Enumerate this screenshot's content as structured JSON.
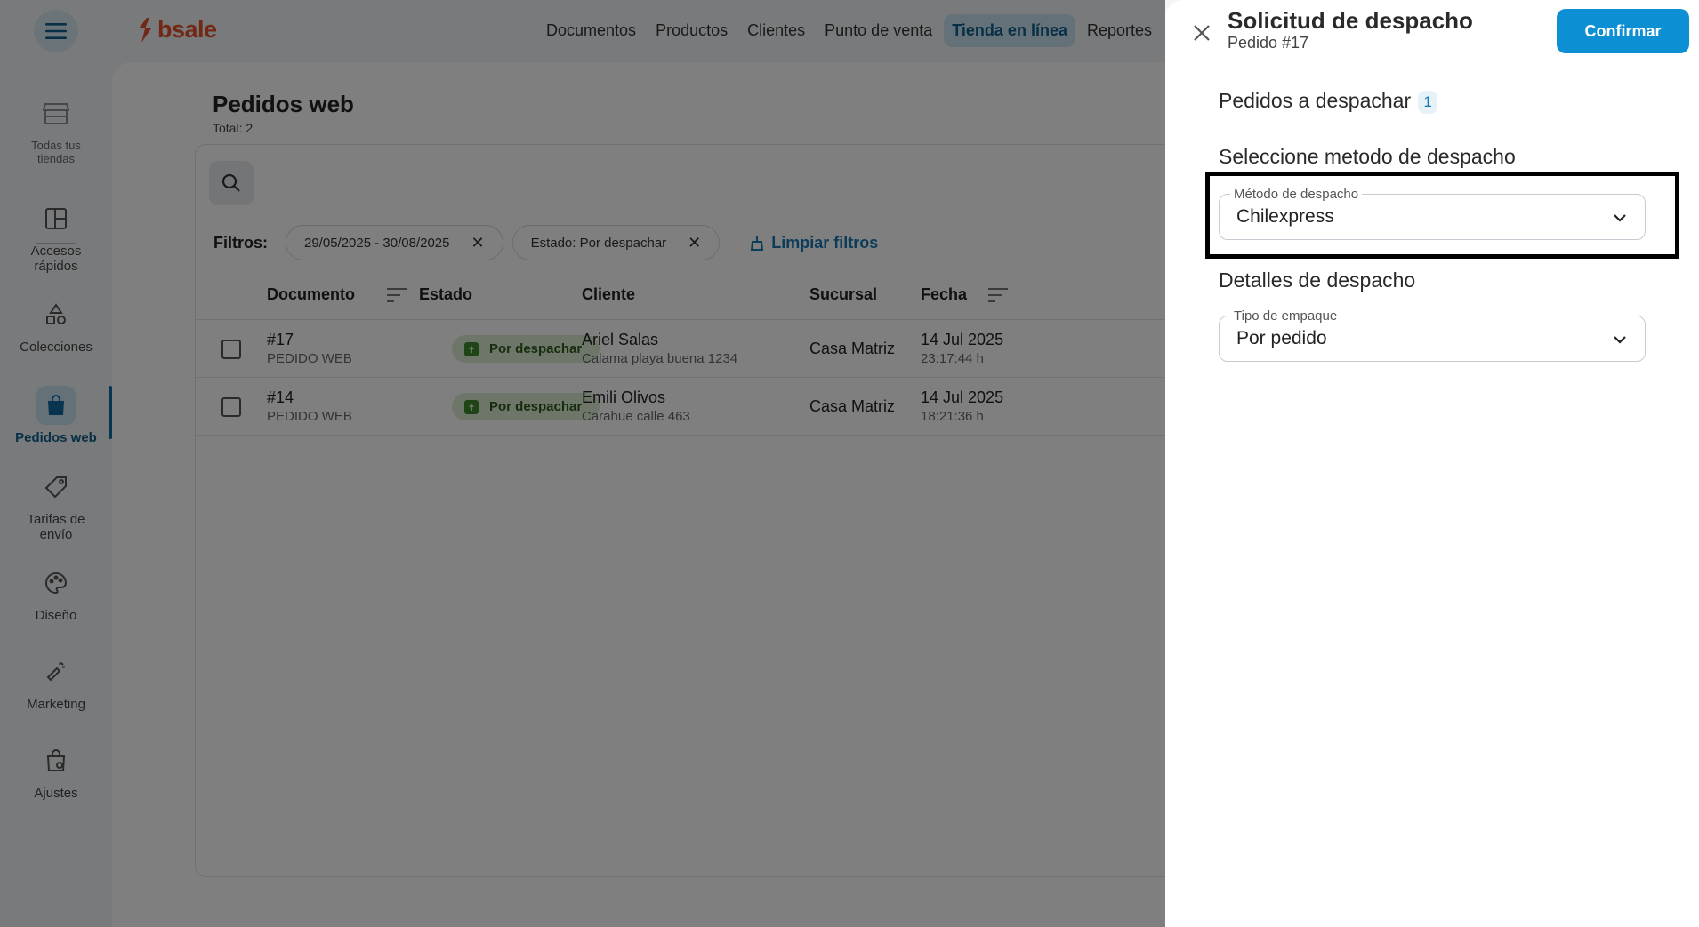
{
  "brand": {
    "logo_text": "bsale",
    "accent": "#e5502b"
  },
  "topnav": {
    "items": [
      "Documentos",
      "Productos",
      "Clientes",
      "Punto de venta",
      "Tienda en línea",
      "Reportes"
    ],
    "active_index": 4
  },
  "sidebar": {
    "items": [
      {
        "label": "Todas tus tiendas",
        "icon": "store-icon"
      },
      {
        "label": "Accesos rápidos",
        "icon": "quick-access-icon"
      },
      {
        "label": "Colecciones",
        "icon": "collections-icon"
      },
      {
        "label": "Pedidos web",
        "icon": "shopping-bag-icon",
        "active": true
      },
      {
        "label": "Tarifas de envío",
        "icon": "tag-icon"
      },
      {
        "label": "Diseño",
        "icon": "palette-icon"
      },
      {
        "label": "Marketing",
        "icon": "megaphone-icon"
      },
      {
        "label": "Ajustes",
        "icon": "settings-bag-icon"
      }
    ]
  },
  "page": {
    "title": "Pedidos web",
    "total": "Total: 2"
  },
  "filters": {
    "label": "Filtros:",
    "chips": [
      "29/05/2025 - 30/08/2025",
      "Estado: Por despachar"
    ],
    "clear_label": "Limpiar filtros"
  },
  "table": {
    "columns": [
      "Documento",
      "Estado",
      "Cliente",
      "Sucursal",
      "Fecha"
    ],
    "rows": [
      {
        "doc": "#17",
        "doc_type": "PEDIDO WEB",
        "status": "Por despachar",
        "client": "Ariel Salas",
        "address": "Calama playa buena 1234",
        "branch": "Casa Matriz",
        "date": "14 Jul 2025",
        "time": "23:17:44 h"
      },
      {
        "doc": "#14",
        "doc_type": "PEDIDO WEB",
        "status": "Por despachar",
        "client": "Emili Olivos",
        "address": "Carahue calle 463",
        "branch": "Casa Matriz",
        "date": "14 Jul 2025",
        "time": "18:21:36 h"
      }
    ]
  },
  "panel": {
    "title": "Solicitud de despacho",
    "subtitle": "Pedido #17",
    "confirm_label": "Confirmar",
    "orders_title": "Pedidos a despachar",
    "orders_count": "1",
    "method_title": "Seleccione metodo de despacho",
    "method_field": {
      "label": "Método de despacho",
      "value": "Chilexpress"
    },
    "details_title": "Detalles de despacho",
    "packaging_field": {
      "label": "Tipo de empaque",
      "value": "Por pedido"
    }
  }
}
